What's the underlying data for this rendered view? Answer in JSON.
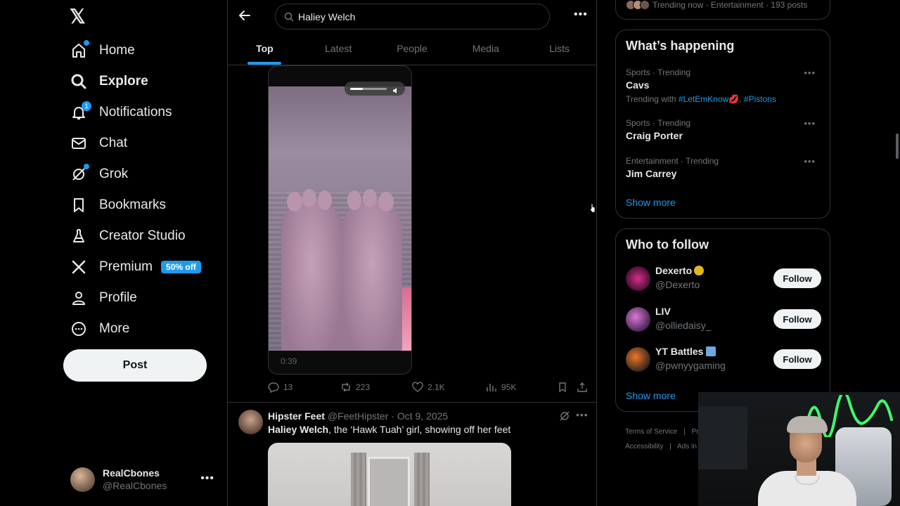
{
  "nav": {
    "items": [
      {
        "label": "Home",
        "icon": "home-icon",
        "has_dot": true
      },
      {
        "label": "Explore",
        "icon": "search-icon",
        "active": true
      },
      {
        "label": "Notifications",
        "icon": "bell-icon",
        "badge": "1"
      },
      {
        "label": "Chat",
        "icon": "mail-icon"
      },
      {
        "label": "Grok",
        "icon": "grok-icon",
        "has_dot": true
      },
      {
        "label": "Bookmarks",
        "icon": "bookmark-icon"
      },
      {
        "label": "Creator Studio",
        "icon": "flask-icon"
      },
      {
        "label": "Premium",
        "icon": "x-logo-icon",
        "badge_text": "50% off"
      },
      {
        "label": "Profile",
        "icon": "person-icon"
      },
      {
        "label": "More",
        "icon": "more-circle-icon"
      }
    ],
    "post_label": "Post"
  },
  "account": {
    "name": "RealCbones",
    "handle": "@RealCbones"
  },
  "search": {
    "value": "Haliey Welch"
  },
  "tabs": [
    {
      "label": "Top",
      "active": true
    },
    {
      "label": "Latest"
    },
    {
      "label": "People"
    },
    {
      "label": "Media"
    },
    {
      "label": "Lists"
    }
  ],
  "post1": {
    "video_time": "0:39",
    "volume_level": 0.35,
    "replies": "13",
    "reposts": "223",
    "likes": "2.1K",
    "views": "95K"
  },
  "post2": {
    "name": "Hipster Feet",
    "handle": "@FeetHipster",
    "date": "· Oct 9, 2025",
    "text_bold": "Haliey Welch",
    "text_rest": ", the ‘Hawk Tuah’ girl, showing off her feet"
  },
  "right": {
    "trending_now": "Trending now · Entertainment · 193 posts",
    "happening_title": "What’s happening",
    "trends": [
      {
        "category": "Sports · Trending",
        "name": "Cavs",
        "with_prefix": "Trending with",
        "tags": [
          "#LetEmKnow",
          "#Pistons"
        ]
      },
      {
        "category": "Sports · Trending",
        "name": "Craig Porter"
      },
      {
        "category": "Entertainment · Trending",
        "name": "Jim Carrey"
      }
    ],
    "show_more": "Show more",
    "follow_title": "Who to follow",
    "follow_label": "Follow",
    "suggestions": [
      {
        "name": "Dexerto",
        "handle": "@Dexerto"
      },
      {
        "name": "LIV",
        "handle": "@olliedaisy_"
      },
      {
        "name": "YT Battles",
        "handle": "@pwnyygaming"
      }
    ],
    "footer_row1": [
      "Terms of Service",
      "Pri"
    ],
    "footer_row2": [
      "Accessibility",
      "Ads in"
    ]
  },
  "colors": {
    "accent": "#1d9bf0",
    "background": "#000000",
    "border": "#2f3336",
    "muted_text": "#71767b"
  }
}
